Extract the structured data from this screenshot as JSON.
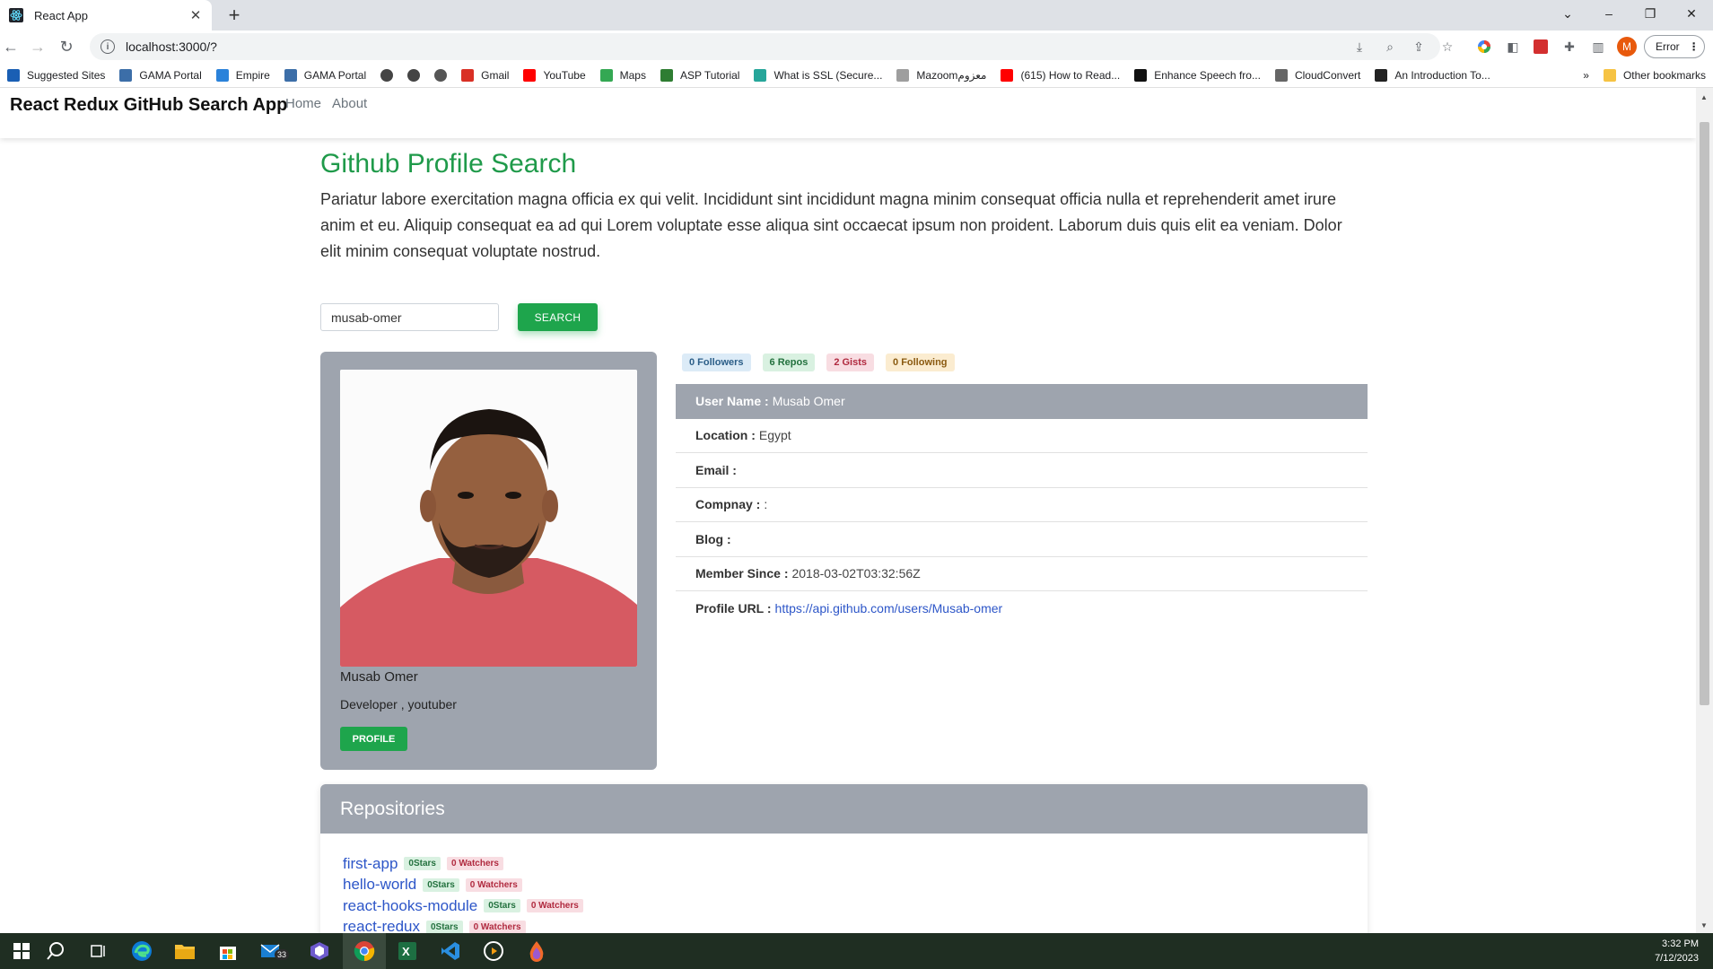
{
  "browser": {
    "tab_title": "React App",
    "url": "localhost:3000/?",
    "error_label": "Error",
    "profile_initial": "M",
    "bookmarks": [
      {
        "label": "Suggested Sites",
        "color": "#1a5fb4"
      },
      {
        "label": "GAMA Portal",
        "color": "#3c6ea8"
      },
      {
        "label": "Empire",
        "color": "#2a82da"
      },
      {
        "label": "GAMA Portal",
        "color": "#3c6ea8"
      },
      {
        "label": "",
        "color": "#444444"
      },
      {
        "label": "",
        "color": "#444444"
      },
      {
        "label": "",
        "color": "#555555"
      },
      {
        "label": "Gmail",
        "color": "#d93025"
      },
      {
        "label": "YouTube",
        "color": "#ff0000"
      },
      {
        "label": "Maps",
        "color": "#34a853"
      },
      {
        "label": "ASP Tutorial",
        "color": "#2e7d32"
      },
      {
        "label": "What is SSL (Secure...",
        "color": "#26a69a"
      },
      {
        "label": "Mazoomمعزوم",
        "color": "#9e9e9e"
      },
      {
        "label": "(615) How to Read...",
        "color": "#ff0000"
      },
      {
        "label": "Enhance Speech fro...",
        "color": "#111111"
      },
      {
        "label": "CloudConvert",
        "color": "#666666"
      },
      {
        "label": "An Introduction To...",
        "color": "#222222"
      }
    ],
    "overflow_label": "»",
    "other_bookmarks": "Other bookmarks"
  },
  "navbar": {
    "brand": "React Redux GitHub Search App",
    "links": [
      "Home",
      "About"
    ]
  },
  "hero": {
    "title": "Github Profile Search",
    "lead": "Pariatur labore exercitation magna officia ex qui velit. Incididunt sint incididunt magna minim consequat officia nulla et reprehenderit amet irure anim et eu. Aliquip consequat ea ad qui Lorem voluptate esse aliqua sint occaecat ipsum non proident. Laborum duis quis elit ea veniam. Dolor elit minim consequat voluptate nostrud."
  },
  "search": {
    "value": "musab-omer",
    "button": "SEARCH"
  },
  "profile": {
    "name": "Musab Omer",
    "bio": "Developer , youtuber",
    "button": "PROFILE"
  },
  "badges": {
    "followers": "0 Followers",
    "repos": "6 Repos",
    "gists": "2 Gists",
    "following": "0 Following"
  },
  "details": [
    {
      "label": "User Name :",
      "value": "Musab Omer"
    },
    {
      "label": "Location :",
      "value": "Egypt"
    },
    {
      "label": "Email :",
      "value": ""
    },
    {
      "label": "Compnay :",
      "value": ":"
    },
    {
      "label": "Blog :",
      "value": ""
    },
    {
      "label": "Member Since :",
      "value": "2018-03-02T03:32:56Z"
    },
    {
      "label": "Profile URL :",
      "value": "https://api.github.com/users/Musab-omer"
    }
  ],
  "repositories": {
    "title": "Repositories",
    "items": [
      {
        "name": "first-app",
        "stars": "0Stars",
        "watchers": "0 Watchers"
      },
      {
        "name": "hello-world",
        "stars": "0Stars",
        "watchers": "0 Watchers"
      },
      {
        "name": "react-hooks-module",
        "stars": "0Stars",
        "watchers": "0 Watchers"
      },
      {
        "name": "react-redux",
        "stars": "0Stars",
        "watchers": "0 Watchers"
      }
    ]
  },
  "taskbar": {
    "time": "3:32 PM",
    "date": "7/12/2023",
    "mail_badge": "33"
  }
}
